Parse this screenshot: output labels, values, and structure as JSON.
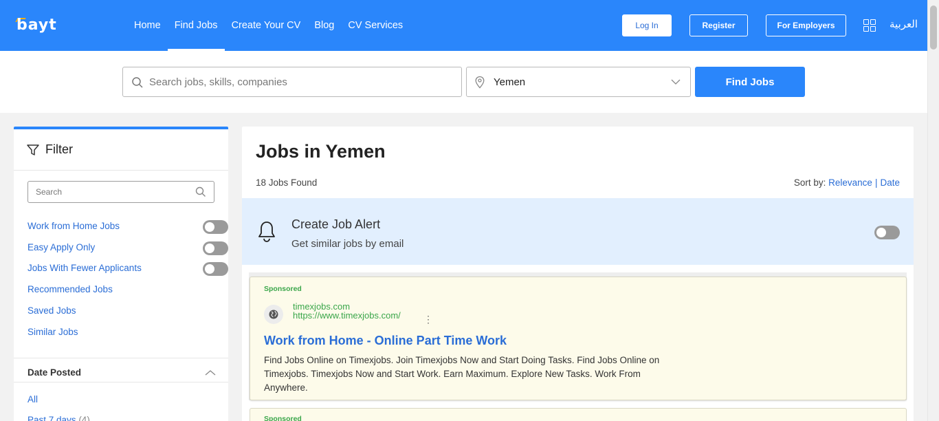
{
  "header": {
    "logo": "bayt",
    "nav": [
      "Home",
      "Find Jobs",
      "Create Your CV",
      "Blog",
      "CV Services"
    ],
    "login": "Log In",
    "register": "Register",
    "employers": "For Employers",
    "language": "العربية"
  },
  "search": {
    "placeholder": "Search jobs, skills, companies",
    "location": "Yemen",
    "button": "Find Jobs"
  },
  "filter": {
    "title": "Filter",
    "search_placeholder": "Search",
    "toggles": [
      "Work from Home Jobs",
      "Easy Apply Only",
      "Jobs With Fewer Applicants"
    ],
    "links": [
      "Recommended Jobs",
      "Saved Jobs",
      "Similar Jobs"
    ],
    "date_posted": {
      "title": "Date Posted",
      "options": [
        {
          "label": "All",
          "count": ""
        },
        {
          "label": "Past 7 days",
          "count": "(4)"
        }
      ]
    }
  },
  "main": {
    "title": "Jobs in Yemen",
    "jobs_found": "18 Jobs Found",
    "sort_label": "Sort by:",
    "sort_options": [
      "Relevance",
      "Date"
    ],
    "alert": {
      "title": "Create Job Alert",
      "subtitle": "Get similar jobs by email"
    },
    "ads": [
      {
        "label": "Sponsored",
        "domain": "timexjobs.com",
        "url": "https://www.timexjobs.com/",
        "headline": "Work from Home - Online Part Time Work",
        "description": "Find Jobs Online on Timexjobs. Join Timexjobs Now and Start Doing Tasks. Find Jobs Online on Timexjobs. Timexjobs Now and Start Work. Earn Maximum. Explore New Tasks. Work From Anywhere."
      },
      {
        "label": "Sponsored"
      }
    ]
  },
  "colors": {
    "brand_blue": "#2a86fb",
    "link_blue": "#2a6dd6",
    "alert_bg": "#e2effe",
    "ad_bg": "#fdfbea",
    "sponsored_green": "#3aa64a"
  }
}
